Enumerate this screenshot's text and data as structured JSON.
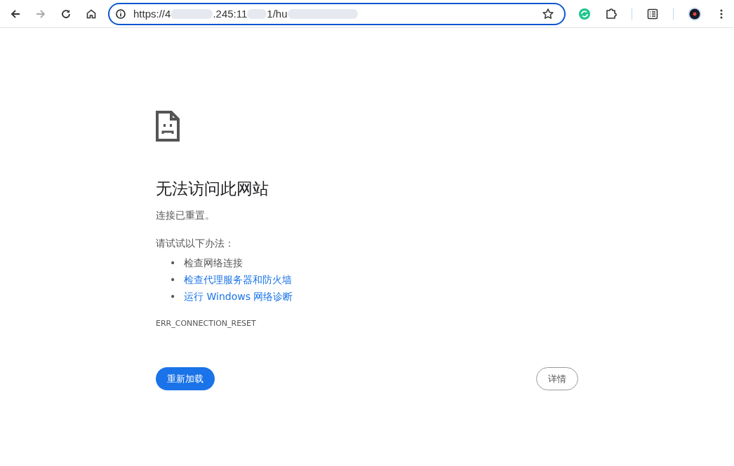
{
  "toolbar": {
    "back_disabled": false,
    "forward_disabled": true
  },
  "address_bar": {
    "url_parts": [
      "https://4",
      ".245:11",
      "1/hu"
    ],
    "focused": true
  },
  "error": {
    "title": "无法访问此网站",
    "message": "连接已重置。",
    "try_label": "请试试以下办法：",
    "suggestions": [
      {
        "bullet": "•",
        "text": "检查网络连接",
        "kind": "text"
      },
      {
        "bullet": "•",
        "text": "检查代理服务器和防火墙",
        "kind": "link"
      },
      {
        "bullet": "•",
        "text": "运行 Windows 网络诊断",
        "kind": "link"
      }
    ],
    "code": "ERR_CONNECTION_RESET"
  },
  "buttons": {
    "reload": "重新加载",
    "details": "详情"
  }
}
